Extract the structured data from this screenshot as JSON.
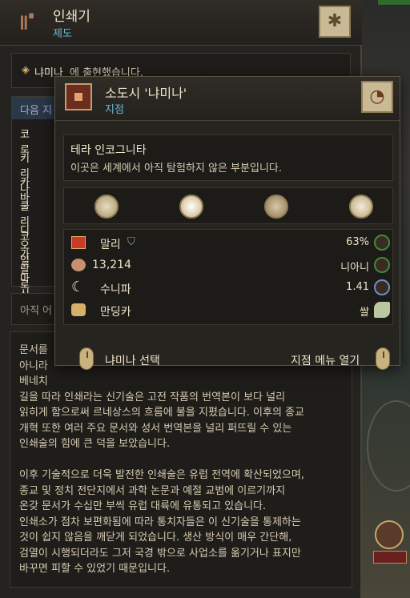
{
  "header": {
    "title": "인쇄기",
    "subtitle": "제도"
  },
  "notice": {
    "text_name": "냐미나",
    "text_rest": "에 출현했습니다."
  },
  "list": {
    "header": "다음 지",
    "items": [
      "코로",
      "키리나",
      "카바",
      "쿨리코",
      "디오일",
      "가랄로",
      "마시귀"
    ]
  },
  "status_line": "아직 어",
  "description": [
    "문서를",
    "아니라",
    "베네치",
    "길을 따라 인쇄라는 신기술은 고전 작품의 번역본이 보다 널리",
    "읽히게 함으로써 르네상스의 흐름에 불을 지폈습니다. 이후의 종교",
    "개혁 또한 여러 주요 문서와 성서 번역본을 널리 퍼뜨릴 수 있는",
    "인쇄술의 힘에 큰 덕을 보았습니다.",
    "",
    "이후 기술적으로 더욱 발전한 인쇄술은 유럽 전역에 확산되었으며,",
    "종교 및 정치 전단지에서 과학 논문과 예절 교범에 이르기까지",
    "온갖 문서가 수십만 부씩 유럽 대륙에 유통되고 있습니다.",
    "인쇄소가 점차 보편화됨에 따라 통치자들은 이 신기술을 통제하는",
    "것이 쉽지 않음을 깨닫게 되었습니다. 생산 방식이 매우 간단해,",
    "검열이 시행되더라도 그저 국경 밖으로 사업소를 옮기거나 표지만",
    "바꾸면 피할 수 있었기 때문입니다."
  ],
  "tooltip": {
    "title": "소도시 '냐미나'",
    "subtitle": "지점",
    "region_name": "테라 인코그니타",
    "region_desc": "이곳은 세계에서 아직 탐험하지 않은 부분입니다.",
    "resources": [
      "sand-icon",
      "light-icon",
      "plant-icon",
      "cotton-icon"
    ],
    "rows": [
      {
        "label": "말리",
        "value": "63%",
        "icon": "flag-icon",
        "extra_icon": "shield-icon",
        "right_icon": "hammer-icon"
      },
      {
        "label": "13,214",
        "value": "니아니",
        "icon": "population-icon",
        "right_icon": "building-icon"
      },
      {
        "label": "수니파",
        "value": "1.41",
        "icon": "crescent-icon",
        "right_icon": "faith-icon"
      },
      {
        "label": "만딩카",
        "value": "쌀",
        "icon": "culture-mask-icon",
        "right_icon": "rice-icon"
      }
    ],
    "select_label": "냐미나 선택",
    "menu_label": "지점 메뉴 열기"
  },
  "colors": {
    "accent_blue": "#6fb7d6",
    "panel_bg": "#25231f",
    "gold": "#c9b994"
  }
}
